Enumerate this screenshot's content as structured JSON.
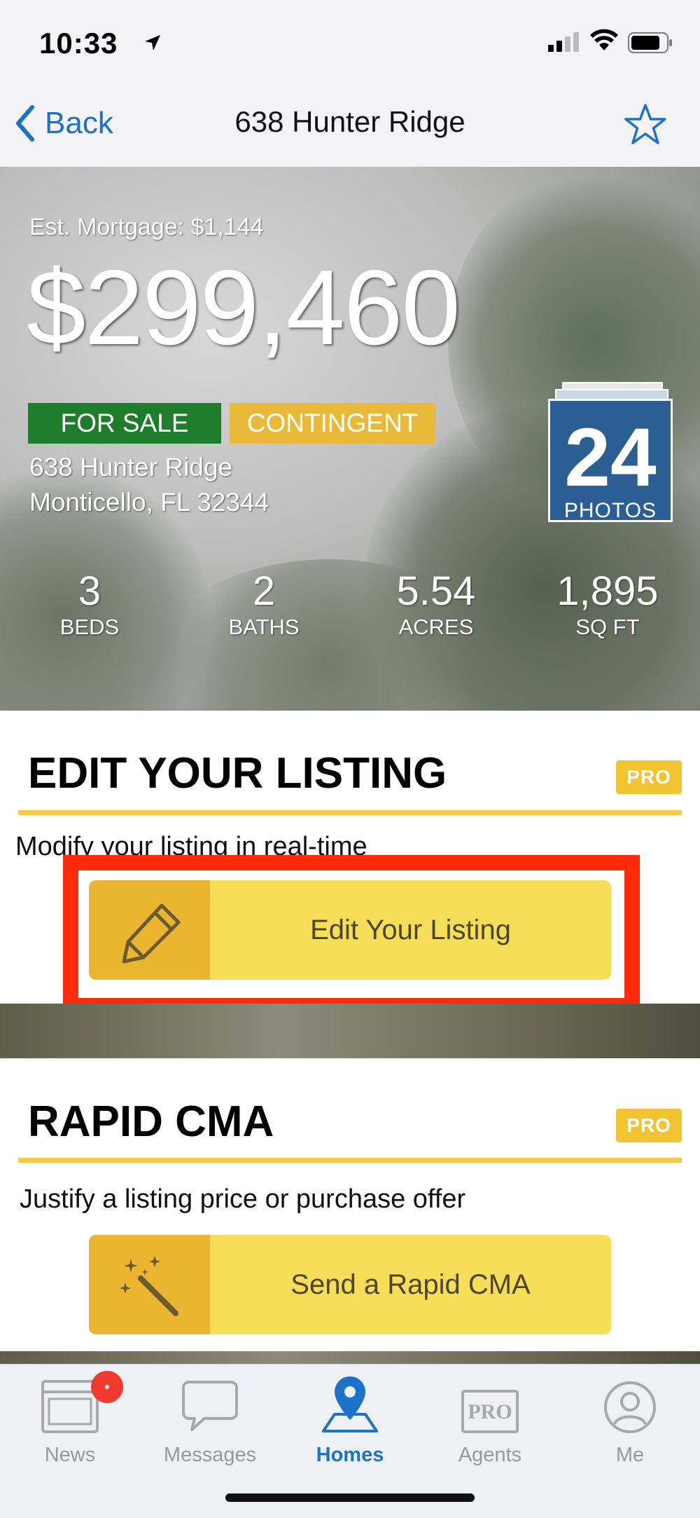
{
  "status_bar": {
    "time": "10:33"
  },
  "nav": {
    "back_label": "Back",
    "title": "638 Hunter Ridge"
  },
  "listing": {
    "est_mortgage": "Est. Mortgage: $1,144",
    "price": "$299,460",
    "badges": [
      "FOR SALE",
      "CONTINGENT"
    ],
    "address_line1": "638 Hunter Ridge",
    "address_line2": "Monticello, FL 32344",
    "photos": {
      "count": "24",
      "label": "PHOTOS"
    },
    "stats": [
      {
        "value": "3",
        "label": "BEDS"
      },
      {
        "value": "2",
        "label": "BATHS"
      },
      {
        "value": "5.54",
        "label": "ACRES"
      },
      {
        "value": "1,895",
        "label": "SQ FT"
      }
    ]
  },
  "edit_section": {
    "title": "EDIT YOUR LISTING",
    "pro_badge": "PRO",
    "description": "Modify your listing in real-time",
    "button_label": "Edit Your Listing"
  },
  "cma_section": {
    "title": "RAPID CMA",
    "pro_badge": "PRO",
    "description": "Justify a listing price or purchase offer",
    "button_label": "Send a Rapid CMA"
  },
  "tabs": [
    {
      "label": "News",
      "icon": "news-icon"
    },
    {
      "label": "Messages",
      "icon": "messages-icon"
    },
    {
      "label": "Homes",
      "icon": "map-pin-icon",
      "active": true
    },
    {
      "label": "Agents",
      "icon": "pro-agents-icon"
    },
    {
      "label": "Me",
      "icon": "user-icon"
    }
  ],
  "colors": {
    "accent_blue": "#1a73c8",
    "highlight_red": "#ff2a0a",
    "button_yellow": "#f7de58",
    "pro_yellow": "#f3c431"
  }
}
